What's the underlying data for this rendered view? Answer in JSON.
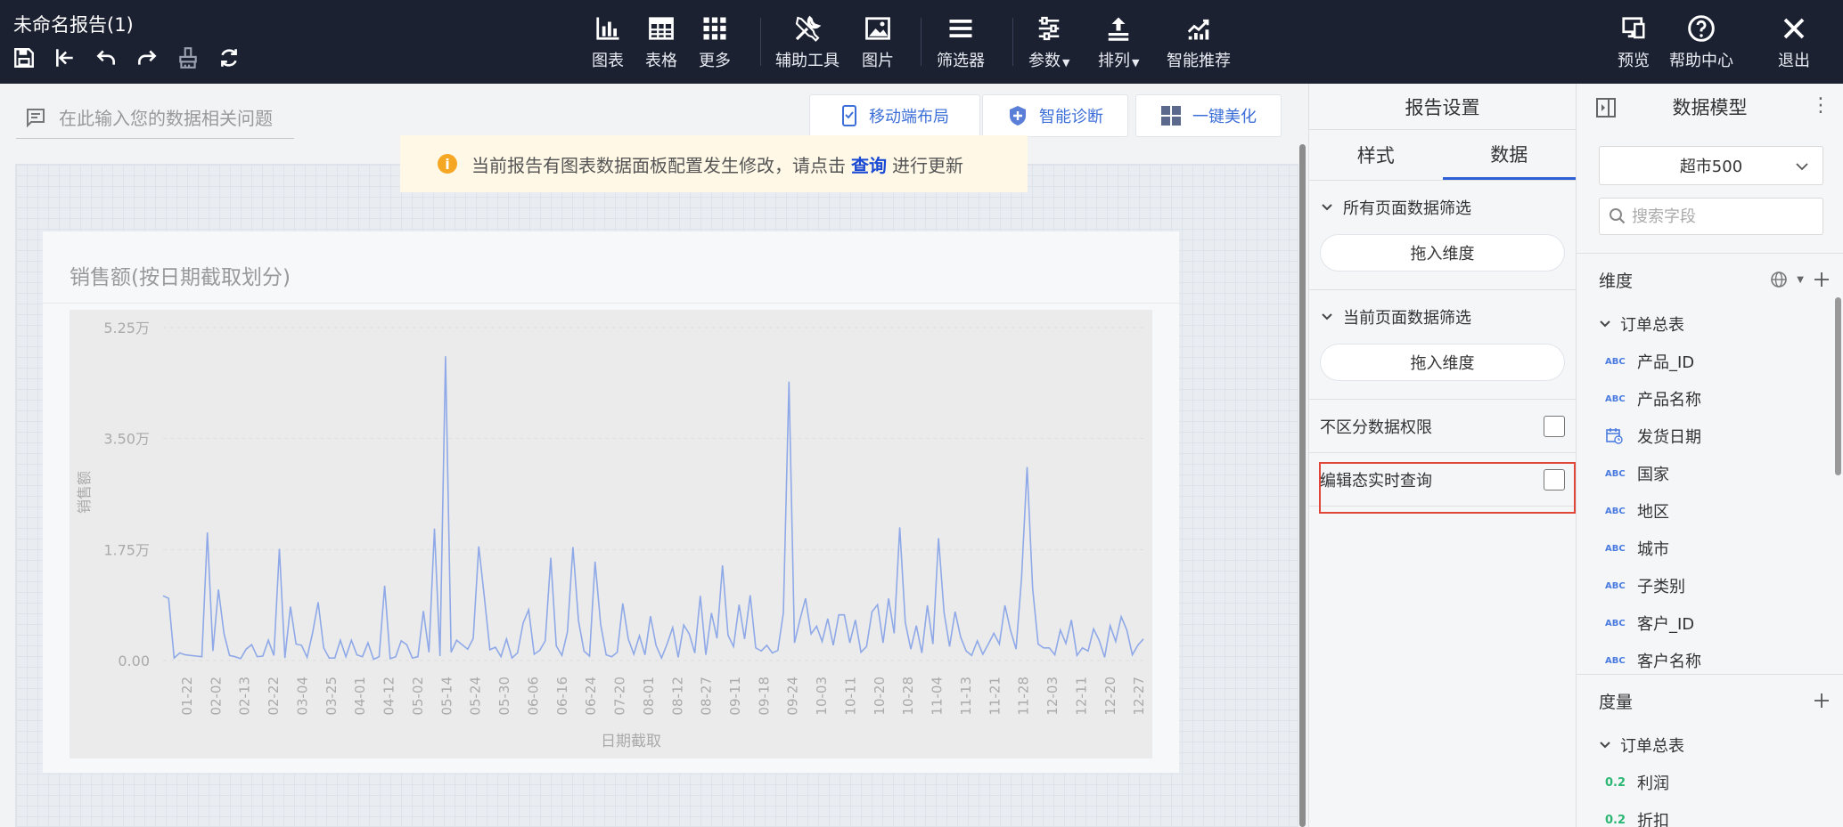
{
  "app": {
    "title": "未命名报告(1)"
  },
  "toolbar": {
    "items": [
      {
        "label": "图表",
        "icon": "bar-chart-icon"
      },
      {
        "label": "表格",
        "icon": "table-icon"
      },
      {
        "label": "更多",
        "icon": "grid-icon"
      },
      {
        "label": "辅助工具",
        "icon": "tools-icon"
      },
      {
        "label": "图片",
        "icon": "image-icon"
      },
      {
        "label": "筛选器",
        "icon": "filter-list-icon"
      },
      {
        "label": "参数",
        "icon": "sliders-icon"
      },
      {
        "label": "排列",
        "icon": "arrange-icon"
      },
      {
        "label": "智能推荐",
        "icon": "smart-chart-icon"
      }
    ],
    "right": [
      {
        "label": "预览",
        "icon": "preview-icon"
      },
      {
        "label": "帮助中心",
        "icon": "help-icon"
      },
      {
        "label": "退出",
        "icon": "close-icon"
      }
    ]
  },
  "ask": {
    "placeholder": "在此输入您的数据相关问题"
  },
  "actions": [
    {
      "label": "移动端布局",
      "icon": "mobile-icon"
    },
    {
      "label": "智能诊断",
      "icon": "shield-icon"
    },
    {
      "label": "一键美化",
      "icon": "layout-icon"
    }
  ],
  "notice": {
    "before": "当前报告有图表数据面板配置发生修改，请点击",
    "link": "查询",
    "after": "进行更新"
  },
  "card": {
    "title": "销售额(按日期截取划分)"
  },
  "chart_data": {
    "type": "line",
    "title": "销售额(按日期截取划分)",
    "xlabel": "日期截取",
    "ylabel": "销售额",
    "ylim": [
      0,
      52500
    ],
    "y_ticks": [
      "0.00",
      "1.75万",
      "3.50万",
      "5.25万"
    ],
    "x_ticks": [
      "01-22",
      "02-02",
      "02-13",
      "02-22",
      "03-04",
      "03-25",
      "04-01",
      "04-12",
      "05-02",
      "05-14",
      "05-24",
      "05-30",
      "06-06",
      "06-16",
      "06-24",
      "07-20",
      "08-01",
      "08-12",
      "08-27",
      "09-11",
      "09-18",
      "09-24",
      "10-03",
      "10-11",
      "10-20",
      "10-28",
      "11-04",
      "11-13",
      "11-21",
      "11-28",
      "12-03",
      "12-11",
      "12-20",
      "12-27"
    ],
    "color": "#8fa9e8",
    "series": [
      {
        "values": [
          10200,
          9800,
          400,
          1200,
          900,
          800,
          700,
          600,
          20200,
          1500,
          11200,
          4200,
          800,
          600,
          300,
          1800,
          2500,
          600,
          700,
          3200,
          800,
          17600,
          400,
          8500,
          2600,
          2400,
          500,
          4400,
          9200,
          2000,
          400,
          400,
          3200,
          600,
          3200,
          900,
          600,
          2800,
          200,
          600,
          11800,
          300,
          600,
          3100,
          2500,
          400,
          600,
          7800,
          1300,
          20800,
          700,
          48000,
          1300,
          3200,
          2500,
          1800,
          3500,
          18000,
          10000,
          1700,
          2100,
          600,
          3400,
          400,
          1200,
          5900,
          8000,
          1000,
          1600,
          3100,
          16200,
          2300,
          800,
          4500,
          17900,
          6300,
          1500,
          700,
          15600,
          5700,
          900,
          600,
          1300,
          9000,
          3400,
          1000,
          3900,
          900,
          7000,
          2400,
          400,
          2600,
          5200,
          500,
          5600,
          4200,
          1200,
          10200,
          900,
          7500,
          3500,
          15000,
          4000,
          2200,
          8800,
          3400,
          10300,
          2000,
          1500,
          2400,
          1200,
          1600,
          7500,
          44000,
          2800,
          6500,
          9800,
          4200,
          5400,
          3000,
          6600,
          2400,
          7200,
          7200,
          2800,
          6400,
          1300,
          2200,
          7700,
          8800,
          2800,
          9800,
          4300,
          21000,
          6000,
          1800,
          5500,
          1200,
          8700,
          2600,
          19300,
          7600,
          2200,
          7700,
          3700,
          1500,
          800,
          3100,
          1000,
          2600,
          4300,
          2600,
          8700,
          4800,
          1800,
          13100,
          30500,
          11400,
          2600,
          2000,
          2000,
          900,
          4800,
          2700,
          6400,
          800,
          2000,
          1500,
          5000,
          3200,
          500,
          5500,
          3000,
          6900,
          4800,
          900,
          2400,
          3400
        ]
      }
    ]
  },
  "settings": {
    "title": "报告设置",
    "tabs": [
      "样式",
      "数据"
    ],
    "active_tab": "数据",
    "all_pages_filter": "所有页面数据筛选",
    "current_page_filter": "当前页面数据筛选",
    "drop_dimension": "拖入维度",
    "no_permission": "不区分数据权限",
    "realtime_query": "编辑态实时查询"
  },
  "model": {
    "title": "数据模型",
    "dataset": "超市500",
    "search_placeholder": "搜索字段",
    "dimensions_label": "维度",
    "measures_label": "度量",
    "table_name": "订单总表",
    "dimension_fields": [
      {
        "type": "ABC",
        "name": "产品_ID"
      },
      {
        "type": "ABC",
        "name": "产品名称"
      },
      {
        "type": "date",
        "name": "发货日期"
      },
      {
        "type": "ABC",
        "name": "国家"
      },
      {
        "type": "ABC",
        "name": "地区"
      },
      {
        "type": "ABC",
        "name": "城市"
      },
      {
        "type": "ABC",
        "name": "子类别"
      },
      {
        "type": "ABC",
        "name": "客户_ID"
      },
      {
        "type": "ABC",
        "name": "客户名称"
      }
    ],
    "measure_fields": [
      {
        "type": "0.2",
        "name": "利润"
      },
      {
        "type": "0.2",
        "name": "折扣"
      }
    ]
  }
}
